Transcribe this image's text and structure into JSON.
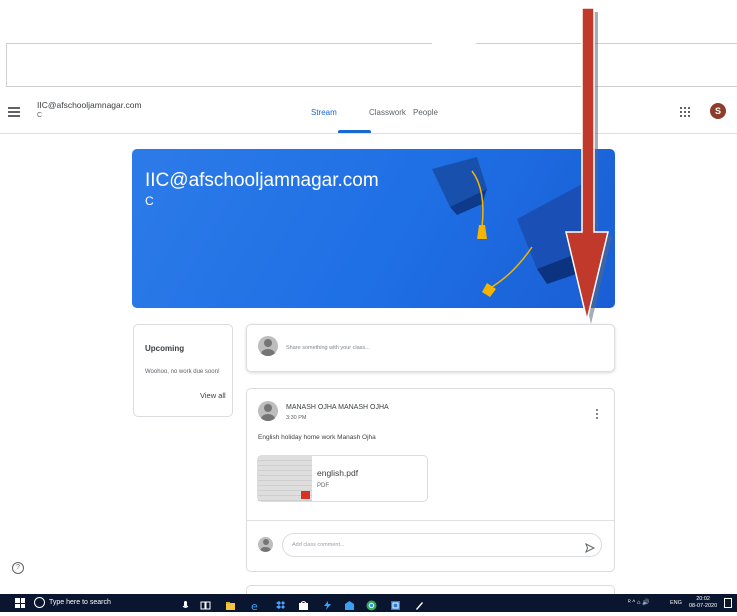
{
  "header": {
    "class_title": "IIC@afschooljamnagar.com",
    "class_section": "C",
    "tabs": [
      {
        "label": "Stream",
        "active": true
      },
      {
        "label": "Classwork",
        "active": false
      },
      {
        "label": "People",
        "active": false
      }
    ],
    "avatar_initial": "S",
    "avatar_color": "#8d3d2a"
  },
  "banner": {
    "title": "IIC@afschooljamnagar.com",
    "section": "C",
    "color": "#1f6fe5"
  },
  "upcoming": {
    "title": "Upcoming",
    "text": "Woohoo, no work due soon!",
    "view_all": "View all"
  },
  "share": {
    "placeholder": "Share something with your class..."
  },
  "post": {
    "author": "MANASH OJHA MANASH OJHA",
    "time": "3:30 PM",
    "text": "English holiday home work Manash Ojha",
    "attachment": {
      "name": "english.pdf",
      "type": "PDF"
    },
    "comment_placeholder": "Add class comment..."
  },
  "help_icon": "?",
  "taskbar": {
    "search_text": "Type here to search",
    "tray_misc": "ᴿ ^ ⌂ 🔊",
    "language": "ENG",
    "time": "20:02",
    "date": "08-07-2020"
  },
  "icons": {
    "menu": "hamburger-icon",
    "apps": "apps-grid-icon",
    "more": "more-vert-icon",
    "send": "send-icon",
    "help": "help-icon",
    "windows": "windows-start-icon"
  },
  "colors": {
    "accent": "#1967d2",
    "arrow": "#c0392b",
    "taskbar": "#0a1630"
  }
}
